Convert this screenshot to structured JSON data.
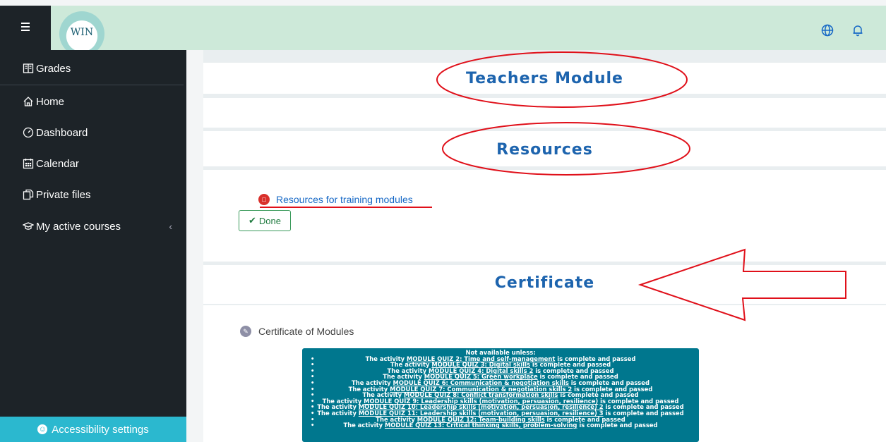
{
  "header": {
    "logo_text": "WIN",
    "icons": [
      "menu-icon",
      "globe-icon",
      "bell-icon"
    ]
  },
  "sidebar": {
    "items": [
      {
        "label": "Grades",
        "icon": "grades-icon"
      },
      {
        "label": "Home",
        "icon": "home-icon"
      },
      {
        "label": "Dashboard",
        "icon": "dashboard-icon"
      },
      {
        "label": "Calendar",
        "icon": "calendar-icon"
      },
      {
        "label": "Private files",
        "icon": "files-icon"
      },
      {
        "label": "My active courses",
        "icon": "courses-icon"
      }
    ],
    "accessibility_label": "Accessibility settings"
  },
  "sections": {
    "teachers_title": "Teachers Module",
    "resources_title": "Resources",
    "resource_link": "Resources for training modules",
    "done_label": "Done",
    "certificate_title": "Certificate",
    "certificate_activity": "Certificate of Modules"
  },
  "restrictions": {
    "header": "Not available unless:",
    "items": [
      {
        "pre": "The activity ",
        "link": "MODULE QUIZ 2: Time and self-management",
        "post": " is complete and passed"
      },
      {
        "pre": "The activity ",
        "link": "MODULE QUIZ 3: Digital skills",
        "post": " is complete and passed"
      },
      {
        "pre": "The activity ",
        "link": "MODULE QUIZ 4: Digital skills 2",
        "post": " is complete and passed"
      },
      {
        "pre": "The activity ",
        "link": "MODULE QUIZ 5: Green workplace",
        "post": " is complete and passed"
      },
      {
        "pre": "The activity ",
        "link": "MODULE QUIZ 6: Communication & negotiation skills",
        "post": " is complete and passed"
      },
      {
        "pre": "The activity ",
        "link": "MODULE QUIZ 7: Communication & negotiation skills 2",
        "post": " is complete and passed"
      },
      {
        "pre": "The activity ",
        "link": "MODULE QUIZ 8: Conflict transformation skills",
        "post": " is complete and passed"
      },
      {
        "pre": "The activity ",
        "link": "MODULE QUIZ 9: Leadership skills (motivation, persuasion, resilience)",
        "post": " is complete and passed"
      },
      {
        "pre": "The activity ",
        "link": "MODULE QUIZ 10: Leadership skills (motivation, persuasion, resilience) 2",
        "post": " is complete and passed"
      },
      {
        "pre": "The activity ",
        "link": "MODULE QUIZ 11: Leadership skills (motivation, persuasion, resilience) 3",
        "post": " is complete and passed"
      },
      {
        "pre": "The activity ",
        "link": "MODULE QUIZ 12: Team-building skills",
        "post": " is complete and passed"
      },
      {
        "pre": "The activity ",
        "link": "MODULE QUIZ 13: Critical thinking skills, problem-solving",
        "post": " is complete and passed"
      }
    ]
  },
  "colors": {
    "topbar": "#cde9d9",
    "sidebar": "#1d2328",
    "accent_blue": "#1d64ae",
    "annotation_red": "#e0101a",
    "restriction_bg": "#00778e",
    "accessibility_bar": "#2bb8cf"
  }
}
